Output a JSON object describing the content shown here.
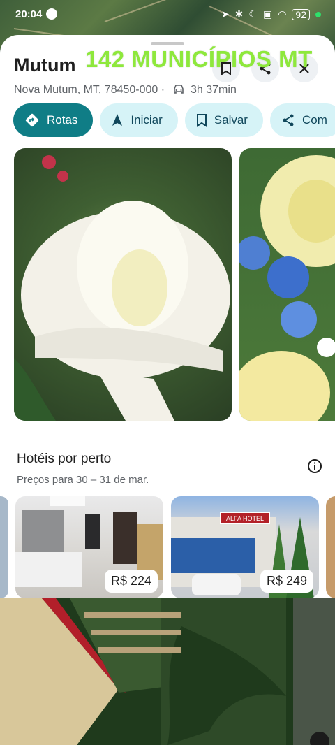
{
  "status": {
    "time": "20:04",
    "battery": "92"
  },
  "overlay": {
    "text": "142 MUNICÍPIOS MT"
  },
  "place": {
    "name": "Mutum",
    "address": "Nova Mutum, MT, 78450-000",
    "separator": "·",
    "drive_time": "3h 37min"
  },
  "chips": [
    {
      "label": "Rotas",
      "icon": "directions-icon"
    },
    {
      "label": "Iniciar",
      "icon": "navigation-arrow-icon"
    },
    {
      "label": "Salvar",
      "icon": "bookmark-icon"
    },
    {
      "label": "Com",
      "icon": "share-icon"
    }
  ],
  "hotels": {
    "title": "Hotéis por perto",
    "subtitle": "Preços para 30 – 31 de mar.",
    "items": [
      {
        "price": "R$ 224"
      },
      {
        "price": "R$ 249",
        "sign": "ALFA HOTEL"
      }
    ]
  },
  "colors": {
    "primary": "#0f7d86",
    "chip_bg": "#d6f3f7",
    "overlay": "#8ee83c"
  }
}
